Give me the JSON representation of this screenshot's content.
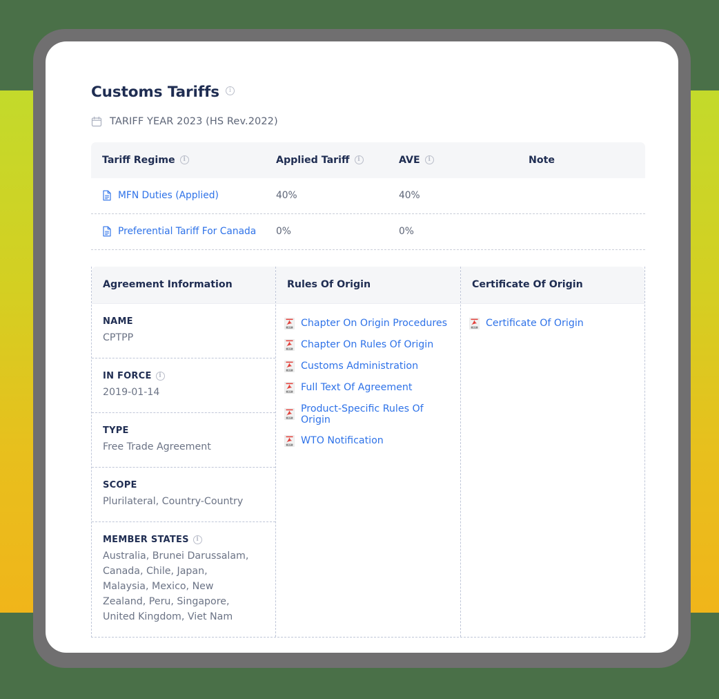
{
  "page": {
    "title": "Customs Tariffs",
    "title_info_icon": "info-icon",
    "tariff_year": "TARIFF YEAR 2023 (HS Rev.2022)",
    "calendar_icon": "calendar-icon"
  },
  "tariff_table": {
    "columns": [
      {
        "label": "Tariff Regime",
        "has_info": true
      },
      {
        "label": "Applied Tariff",
        "has_info": true
      },
      {
        "label": "AVE",
        "has_info": true
      },
      {
        "label": "Note",
        "has_info": false
      }
    ],
    "rows": [
      {
        "regime": "MFN Duties (Applied)",
        "applied_tariff": "40%",
        "ave": "40%",
        "note": "",
        "icon": "document-icon"
      },
      {
        "regime": "Preferential Tariff For Canada",
        "applied_tariff": "0%",
        "ave": "0%",
        "note": "",
        "icon": "document-icon"
      }
    ]
  },
  "agreement": {
    "headers": {
      "information": "Agreement Information",
      "rules_of_origin": "Rules Of Origin",
      "certificate_of_origin": "Certificate Of Origin"
    },
    "fields": [
      {
        "label": "NAME",
        "has_info": false,
        "value": "CPTPP"
      },
      {
        "label": "IN FORCE",
        "has_info": true,
        "value": "2019-01-14"
      },
      {
        "label": "TYPE",
        "has_info": false,
        "value": "Free Trade Agreement"
      },
      {
        "label": "SCOPE",
        "has_info": false,
        "value": "Plurilateral, Country-Country"
      },
      {
        "label": "MEMBER STATES",
        "has_info": true,
        "value": "Australia, Brunei Darussalam, Canada, Chile, Japan, Malaysia, Mexico, New Zealand, Peru, Singapore, United Kingdom, Viet Nam"
      }
    ],
    "rules_of_origin_links": [
      {
        "label": "Chapter On Origin Procedures",
        "icon": "pdf-icon"
      },
      {
        "label": "Chapter On Rules Of Origin",
        "icon": "pdf-icon"
      },
      {
        "label": "Customs Administration",
        "icon": "pdf-icon"
      },
      {
        "label": "Full Text Of Agreement",
        "icon": "pdf-icon"
      },
      {
        "label": "Product-Specific Rules Of Origin",
        "icon": "pdf-icon"
      },
      {
        "label": "WTO Notification",
        "icon": "pdf-icon"
      }
    ],
    "certificate_links": [
      {
        "label": "Certificate Of Origin",
        "icon": "pdf-icon"
      }
    ]
  },
  "colors": {
    "link_blue": "#2e72e8",
    "heading_navy": "#1f2d52",
    "body_gray": "#6b7385",
    "header_bg": "#f5f6f8",
    "pdf_red": "#e2403a",
    "frame_gray": "#706f70",
    "bg_green": "#4a7048",
    "band_top": "#c3da2b",
    "band_bottom": "#f0b51a"
  }
}
